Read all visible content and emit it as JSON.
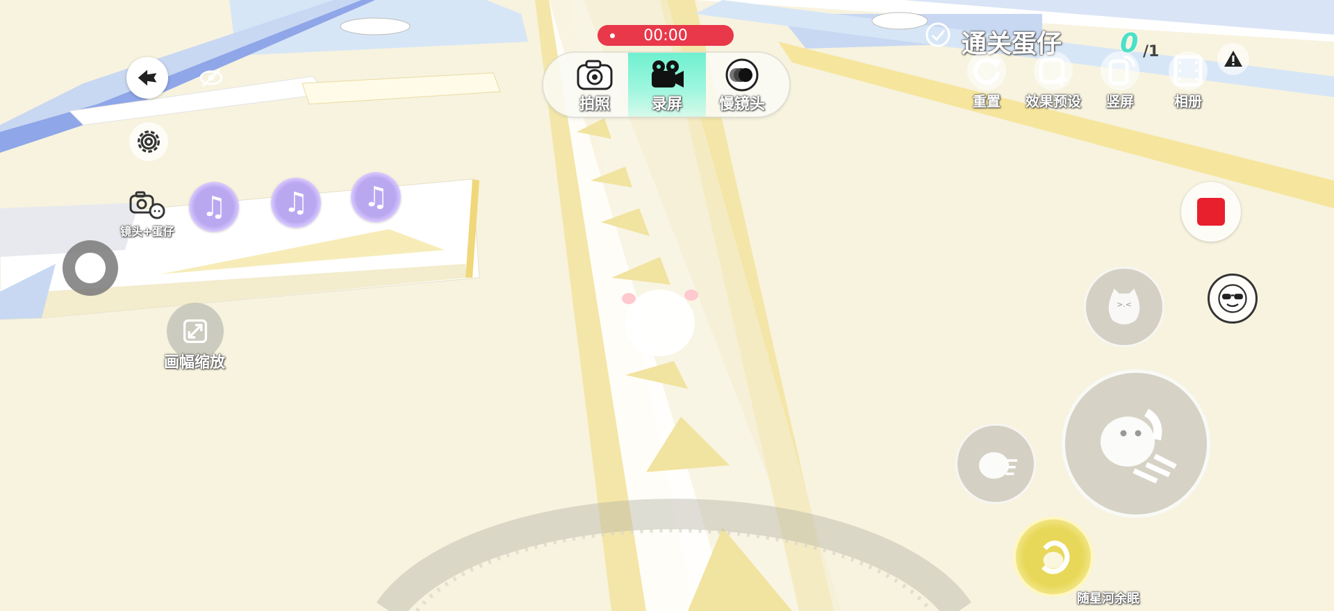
{
  "recording": {
    "timer": "00:00"
  },
  "capture_modes": [
    {
      "label": "拍照",
      "icon": "camera-icon"
    },
    {
      "label": "录屏",
      "icon": "video-camera-icon",
      "selected": true
    },
    {
      "label": "慢镜头",
      "icon": "slow-motion-icon"
    }
  ],
  "objective": {
    "label": "通关蛋仔",
    "count": "0",
    "total": "/1"
  },
  "top_tools": [
    {
      "label": "重置",
      "icon": "reset-icon"
    },
    {
      "label": "效果预设",
      "icon": "effect-preset-icon"
    },
    {
      "label": "竖屏",
      "icon": "portrait-rotate-icon"
    },
    {
      "label": "相册",
      "icon": "film-album-icon"
    }
  ],
  "left_tools": {
    "camera_egg_label": "镜头+蛋仔",
    "zoom_label": "画幅缩放",
    "music_buttons": 3
  },
  "watermark": "随星河余眠",
  "colors": {
    "record_red": "#e8384a",
    "mode_highlight": "#6ff0cf",
    "music_purple": "#b9a8f0",
    "stop_red": "#e8202e"
  }
}
